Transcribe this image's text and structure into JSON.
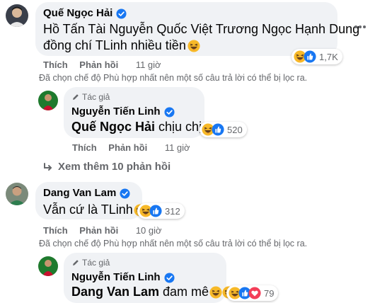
{
  "comments": [
    {
      "author": "Quế Ngọc Hải",
      "text_line1": "Hồ Tấn Tài Nguyễn Quốc Việt Trương Ngọc Hạnh Dung",
      "text_line2": "đồng chí TLinh nhiều tiền",
      "reaction_count": "1,7K",
      "actions": {
        "like": "Thích",
        "reply": "Phản hồi",
        "time": "11 giờ"
      },
      "filter_note": "Đã chọn chế độ Phù hợp nhất nên một số câu trả lời có thể bị lọc ra."
    },
    {
      "author_label": "Tác giả",
      "author": "Nguyễn Tiến Linh",
      "tag": "Quế Ngọc Hải",
      "text": " chịu chịu",
      "reaction_count": "520",
      "actions": {
        "like": "Thích",
        "reply": "Phản hồi",
        "time": "11 giờ"
      }
    },
    {
      "more_replies": "Xem thêm 10 phản hồi"
    },
    {
      "author": "Dang Van Lam",
      "text": "Vẫn cứ là TLinh",
      "reaction_count": "312",
      "actions": {
        "like": "Thích",
        "reply": "Phản hồi",
        "time": "10 giờ"
      },
      "filter_note": "Đã chọn chế độ Phù hợp nhất nên một số câu trả lời có thể bị lọc ra."
    },
    {
      "author_label": "Tác giả",
      "author": "Nguyễn Tiến Linh",
      "tag": "Dang Van Lam",
      "text": " đam mê",
      "reaction_count": "79"
    }
  ],
  "colors": {
    "like_blue": "#1877f2",
    "haha_yellow": "#f7b928",
    "love_red": "#f33e58",
    "bubble": "#f0f2f5",
    "secondary_text": "#65676b"
  },
  "icons": [
    "verified-badge-icon",
    "haha-emoji-icon",
    "like-reaction-icon",
    "love-reaction-icon",
    "reply-arrow-icon",
    "more-options-icon",
    "author-pen-icon"
  ]
}
